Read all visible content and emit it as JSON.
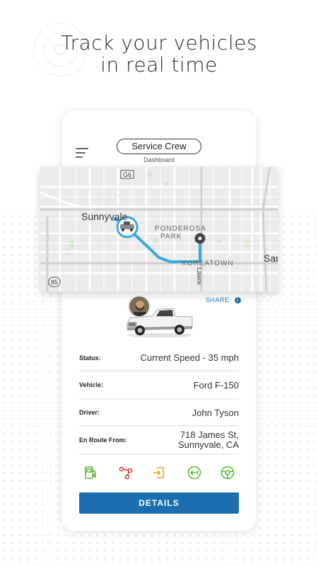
{
  "headline": {
    "line1": "Track your vehicles",
    "line2": "in real time"
  },
  "header": {
    "crew_label": "Service Crew",
    "subtitle": "Dashboard"
  },
  "map": {
    "labels": {
      "highway_g6": "G6",
      "highway_85": "85",
      "city": "Sunnyvale",
      "park_line1": "PONDEROSA",
      "park_line2": "PARK",
      "district": "KOREATOWN",
      "street": "Lawre",
      "city_edge": "San"
    },
    "route_color": "#3aa8df"
  },
  "share_label": "SHARE",
  "vehicle_info": [
    {
      "label": "Status:",
      "value": "Current Speed - 35 mph"
    },
    {
      "label": "Vehicle:",
      "value": "Ford F-150"
    },
    {
      "label": "Driver:",
      "value": "John Tyson"
    },
    {
      "label": "En Route From:",
      "value_line1": "718 James St,",
      "value_line2": "Sunnyvale, CA"
    }
  ],
  "action_icons": [
    {
      "name": "fuel-icon",
      "color": "#5fb839"
    },
    {
      "name": "route-stops-icon",
      "color": "#d0423a"
    },
    {
      "name": "exit-arrow-icon",
      "color": "#e6a21c"
    },
    {
      "name": "back-left-icon",
      "color": "#5fb839"
    },
    {
      "name": "steering-wheel-icon",
      "color": "#5fb839"
    }
  ],
  "details_label": "DETAILS",
  "colors": {
    "accent": "#1b6fb0",
    "route": "#3aa8df"
  }
}
